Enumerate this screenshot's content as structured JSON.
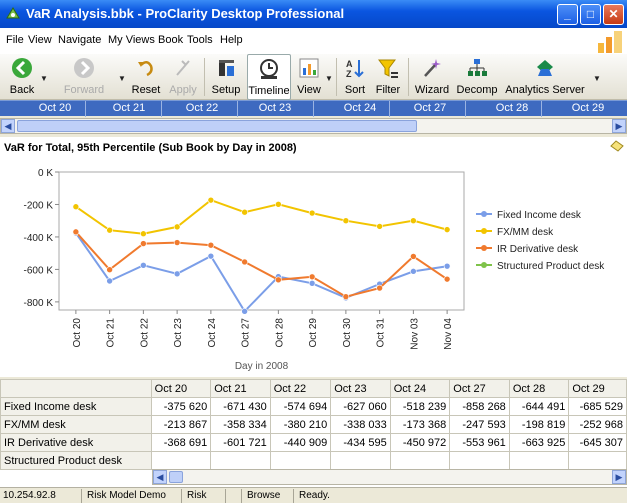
{
  "window": {
    "title": "VaR Analysis.bbk - ProClarity Desktop Professional"
  },
  "menu": [
    "File",
    "View",
    "Navigate",
    "My Views",
    "Book",
    "Tools",
    "Help"
  ],
  "toolbar": {
    "back": "Back",
    "forward": "Forward",
    "reset": "Reset",
    "apply": "Apply",
    "setup": "Setup",
    "timeline": "Timeline",
    "view": "View",
    "sort": "Sort",
    "filter": "Filter",
    "wizard": "Wizard",
    "decomp": "Decomp",
    "analytics": "Analytics Server"
  },
  "timeline": [
    "Oct 20",
    "Oct 21",
    "Oct 22",
    "Oct 23",
    "Oct 24",
    "Oct 27",
    "Oct 28",
    "Oct 29"
  ],
  "chart_data": {
    "type": "line",
    "title": "VaR for Total, 95th Percentile (Sub Book by Day in 2008)",
    "xlabel": "Day in 2008",
    "ylabel": "",
    "categories": [
      "Oct 20",
      "Oct 21",
      "Oct 22",
      "Oct 23",
      "Oct 24",
      "Oct 27",
      "Oct 28",
      "Oct 29",
      "Oct 30",
      "Oct 31",
      "Nov 03",
      "Nov 04"
    ],
    "ylim": [
      -850000,
      0
    ],
    "yticks": [
      {
        "v": 0,
        "label": "0 K"
      },
      {
        "v": -200000,
        "label": "-200 K"
      },
      {
        "v": -400000,
        "label": "-400 K"
      },
      {
        "v": -600000,
        "label": "-600 K"
      },
      {
        "v": -800000,
        "label": "-800 K"
      }
    ],
    "grid": false,
    "legend": "right",
    "series": [
      {
        "name": "Fixed Income desk",
        "color": "#7b9ee8",
        "values": [
          -375620,
          -671430,
          -574694,
          -627060,
          -518239,
          -858268,
          -644491,
          -685529,
          -775000,
          -690000,
          -612000,
          -580000
        ]
      },
      {
        "name": "FX/MM desk",
        "color": "#f2c400",
        "values": [
          -213867,
          -358334,
          -380210,
          -338033,
          -173368,
          -247593,
          -198819,
          -252968,
          -300000,
          -335000,
          -300000,
          -355000
        ]
      },
      {
        "name": "IR Derivative desk",
        "color": "#f07a2e",
        "values": [
          -368691,
          -601721,
          -440909,
          -434595,
          -450972,
          -553961,
          -663925,
          -645307,
          -768000,
          -715000,
          -520000,
          -660000
        ]
      },
      {
        "name": "Structured Product desk",
        "color": "#7fc34a",
        "values": []
      }
    ]
  },
  "table": {
    "columns": [
      "",
      "Oct 20",
      "Oct 21",
      "Oct 22",
      "Oct 23",
      "Oct 24",
      "Oct 27",
      "Oct 28",
      "Oct 29"
    ],
    "rows": [
      {
        "label": "Fixed Income desk",
        "cells": [
          "-375 620",
          "-671 430",
          "-574 694",
          "-627 060",
          "-518 239",
          "-858 268",
          "-644 491",
          "-685 529"
        ]
      },
      {
        "label": "FX/MM desk",
        "cells": [
          "-213 867",
          "-358 334",
          "-380 210",
          "-338 033",
          "-173 368",
          "-247 593",
          "-198 819",
          "-252 968"
        ]
      },
      {
        "label": "IR Derivative desk",
        "cells": [
          "-368 691",
          "-601 721",
          "-440 909",
          "-434 595",
          "-450 972",
          "-553 961",
          "-663 925",
          "-645 307"
        ]
      },
      {
        "label": "Structured Product desk",
        "cells": [
          "",
          "",
          "",
          "",
          "",
          "",
          "",
          ""
        ]
      }
    ]
  },
  "status": [
    "10.254.92.8",
    "Risk Model Demo",
    "Risk",
    "",
    "Browse",
    "Ready."
  ]
}
